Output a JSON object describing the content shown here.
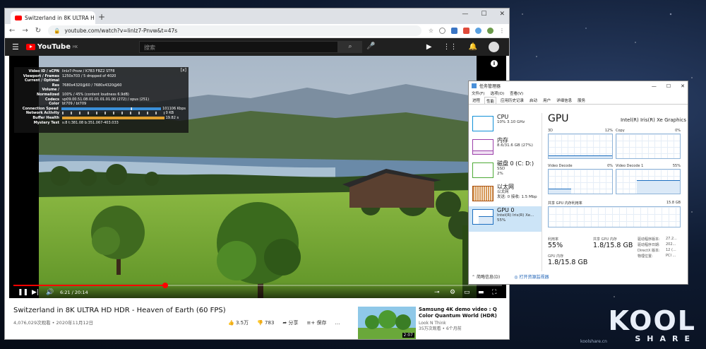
{
  "browser": {
    "tab_title": "Switzerland in 8K ULTRA H",
    "url": "youtube.com/watch?v=linlz7-Pnvw&t=47s",
    "new_tab": "+",
    "tab_close": "×"
  },
  "youtube": {
    "logo": "YouTube",
    "region": "HK",
    "search_placeholder": "搜索",
    "info_icon": "i",
    "stats": [
      {
        "k": "Video ID / sCPN",
        "v": "linlz7-Pnvw / K7B3 FBZ2 STF8"
      },
      {
        "k": "Viewport / Frames",
        "v": "1250x703 / 5 dropped of 4020"
      },
      {
        "k": "Current / Optimal",
        "v": ""
      },
      {
        "k": "Res",
        "v": "7680x4320@60 / 7680x4320@60"
      },
      {
        "k": "Volume /",
        "v": ""
      },
      {
        "k": "Normalized",
        "v": "100% / 45% (content loudness 6.9dB)"
      },
      {
        "k": "Codecs",
        "v": "vp09.00.51.08.01.01.01.01.00 (272) / opus (251)"
      },
      {
        "k": "Color",
        "v": "bt709 / bt709"
      },
      {
        "k": "Connection Speed",
        "v": "101106 Kbps"
      },
      {
        "k": "Network Activity",
        "v": "0 KB"
      },
      {
        "k": "Buffer Health",
        "v": "19.82 s"
      },
      {
        "k": "Mystery Text",
        "v": "s:8 t:381.08 b:351.067-403.033"
      }
    ],
    "stats_close": "[x]",
    "time": "6:21 / 20:14",
    "progress_fraction": 0.31,
    "video_title": "Switzerland in 8K ULTRA HD HDR - Heaven of Earth (60 FPS)",
    "video_meta": "4,076,029次观看 • 2020年11月12日",
    "likes": "3.5万",
    "dislikes": "783",
    "share": "分享",
    "save": "保存",
    "more": "…",
    "rec": {
      "title": "Samsung 4K demo video : Q Color Quantum World (HDR)",
      "channel": "Look N Think",
      "views": "35万次观看 • 6个月前",
      "duration": "2:07"
    }
  },
  "taskmgr": {
    "title": "任务管理器",
    "menu": [
      "文件(F)",
      "选项(O)",
      "查看(V)"
    ],
    "tabs": [
      "进程",
      "性能",
      "应用历史记录",
      "启动",
      "用户",
      "详细信息",
      "服务"
    ],
    "active_tab": 1,
    "resources": [
      {
        "name": "CPU",
        "l1": "10% 3.10 GHz",
        "l2": "",
        "color": "#1190d8"
      },
      {
        "name": "内存",
        "l1": "8.6/31.6 GB (27%)",
        "l2": "",
        "color": "#9b3fa9"
      },
      {
        "name": "磁盘 0 (C: D:)",
        "l1": "SSD",
        "l2": "2%",
        "color": "#4daa36"
      },
      {
        "name": "以太网",
        "l1": "以太网",
        "l2": "发送: 0 接收: 1.5 Mbp",
        "color": "#a74f0d"
      },
      {
        "name": "GPU 0",
        "l1": "Intel(R) Iris(R) Xe...",
        "l2": "55%",
        "color": "#1e6fbf"
      }
    ],
    "gpu_title": "GPU",
    "gpu_name": "Intel(R) Iris(R) Xe Graphics",
    "engines": [
      {
        "label": "3D",
        "pct": "12%"
      },
      {
        "label": "Copy",
        "pct": "0%"
      },
      {
        "label": "Video Decode",
        "pct": "0%"
      },
      {
        "label": "Video Decode 1",
        "pct": "55%"
      }
    ],
    "shared_label": "共享 GPU 内存利用率",
    "shared_max": "15.8 GB",
    "util_label": "利用率",
    "util_value": "55%",
    "shared_mem_label": "共享 GPU 内存",
    "shared_mem_value": "1.8/15.8 GB",
    "gpu_mem_label": "GPU 内存",
    "gpu_mem_value": "1.8/15.8 GB",
    "kv": [
      {
        "k": "驱动程序版本:",
        "v": "27.2..."
      },
      {
        "k": "驱动程序日期:",
        "v": "202..."
      },
      {
        "k": "DirectX 版本:",
        "v": "12 (..."
      },
      {
        "k": "物理位置:",
        "v": "PCI ..."
      }
    ],
    "fewer": "简略信息(D)",
    "open_monitor": "打开资源监视器"
  },
  "watermark": {
    "logo": "KOOL",
    "sub": "SHARE",
    "site": "koolshare.cn"
  }
}
